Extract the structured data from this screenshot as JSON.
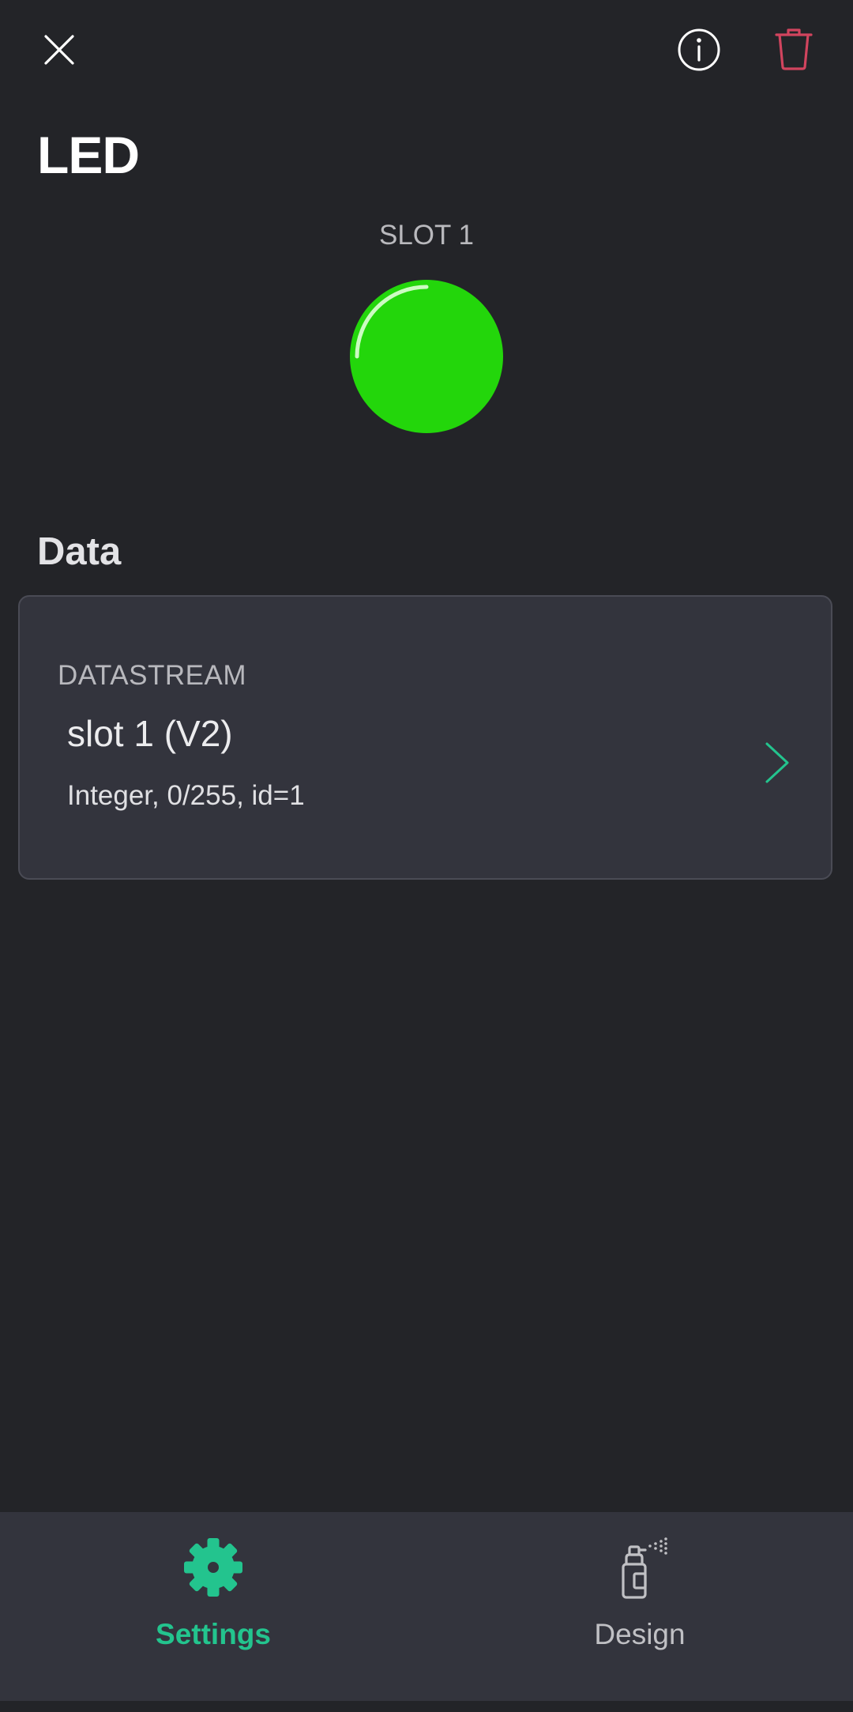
{
  "widget": {
    "title": "LED",
    "preview_label": "SLOT 1",
    "led_color": "#23d60b"
  },
  "data_section": {
    "title": "Data",
    "datastream": {
      "label": "DATASTREAM",
      "name": "slot 1 (V2)",
      "details": "Integer, 0/255, id=1"
    }
  },
  "colors": {
    "accent": "#23c48e",
    "delete": "#d1445e",
    "background": "#232428",
    "card": "#33343d"
  },
  "bottom_nav": {
    "tabs": [
      {
        "label": "Settings",
        "icon": "gear-icon",
        "active": true
      },
      {
        "label": "Design",
        "icon": "spray-can-icon",
        "active": false
      }
    ]
  }
}
